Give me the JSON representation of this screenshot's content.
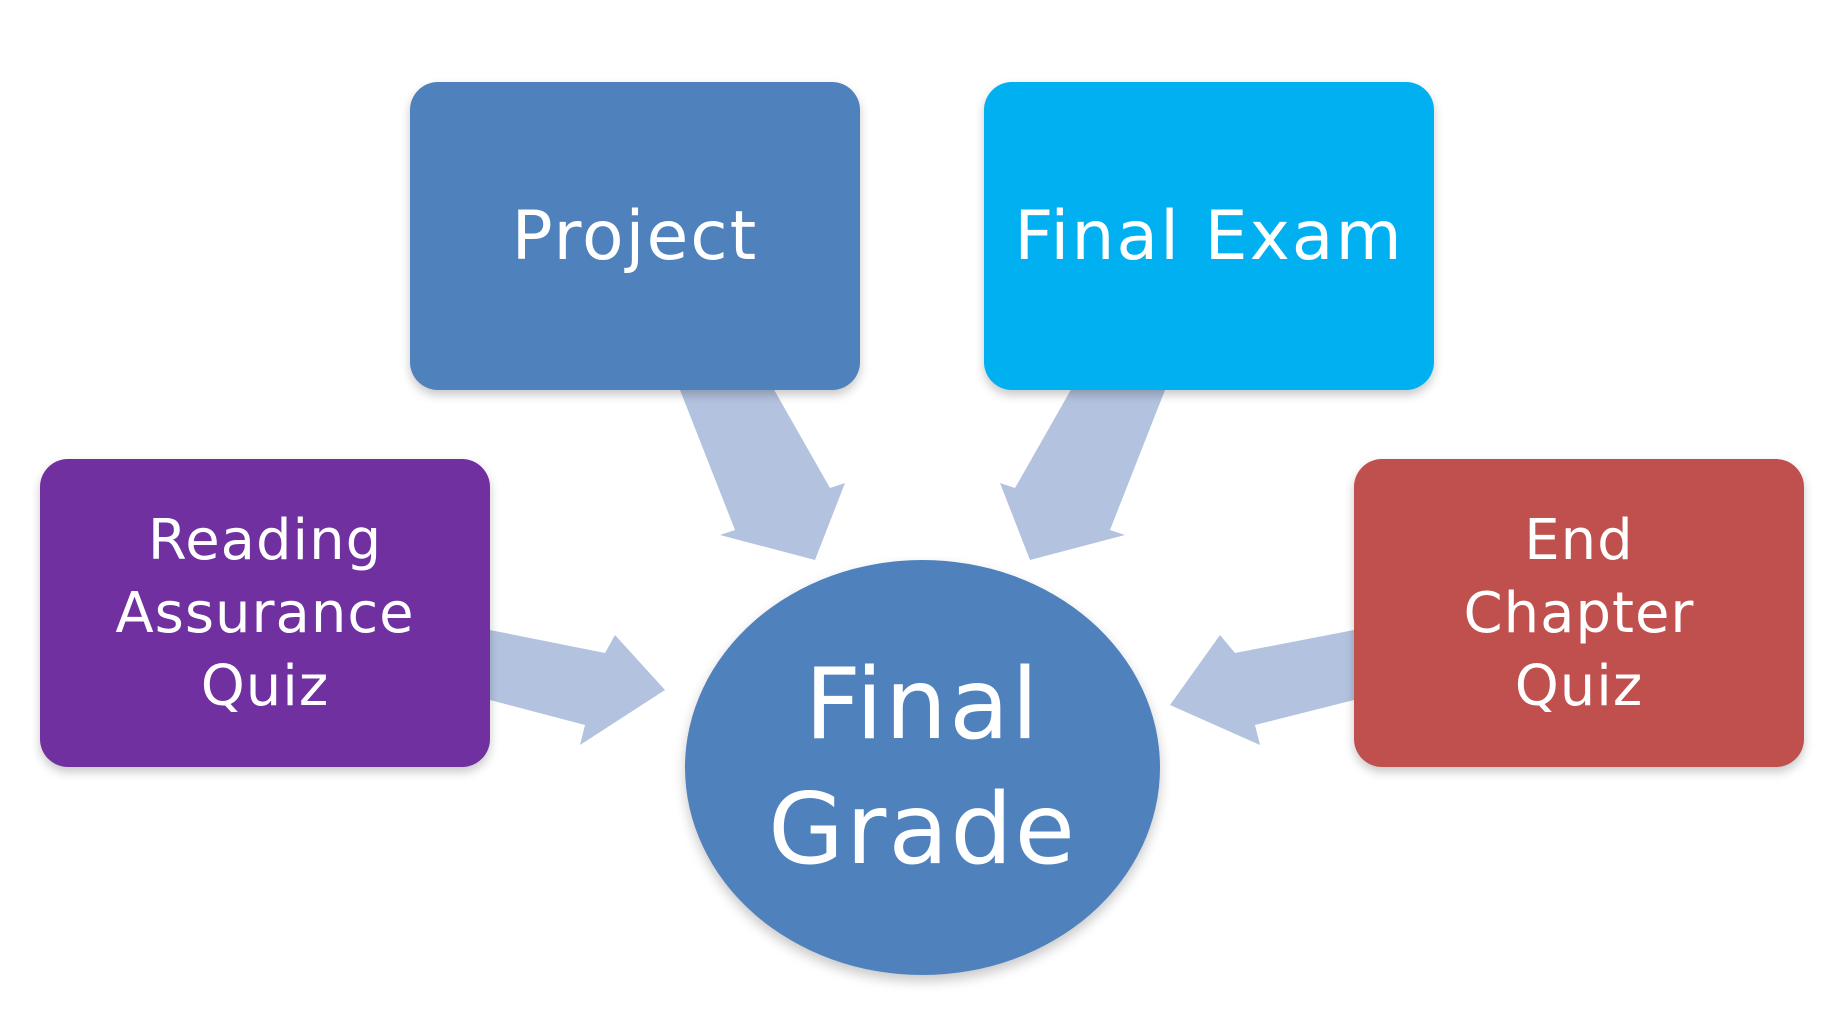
{
  "diagram": {
    "center": {
      "label": "Final\nGrade",
      "color": "#4f81bd"
    },
    "inputs": [
      {
        "id": "project",
        "label": "Project",
        "color": "#4f81bd"
      },
      {
        "id": "final_exam",
        "label": "Final Exam",
        "color": "#00b0f0"
      },
      {
        "id": "reading",
        "label": "Reading\nAssurance\nQuiz",
        "color": "#7030a0"
      },
      {
        "id": "end_chapter",
        "label": "End\nChapter\nQuiz",
        "color": "#c0504d"
      }
    ],
    "arrow_color": "#b3c3df"
  }
}
